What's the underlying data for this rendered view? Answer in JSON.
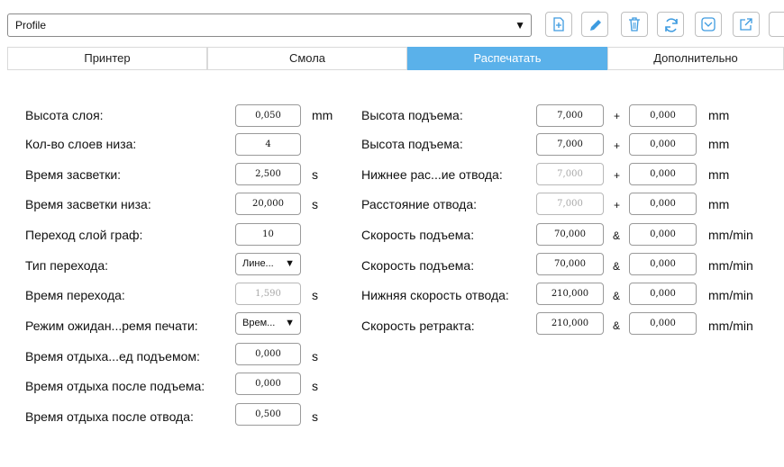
{
  "profile": {
    "value": "Profile"
  },
  "toolbar": {
    "buttons": [
      "new-profile",
      "edit",
      "delete",
      "refresh",
      "import",
      "export",
      "more"
    ]
  },
  "tabs": [
    {
      "label": "Принтер",
      "active": false
    },
    {
      "label": "Смола",
      "active": false
    },
    {
      "label": "Распечатать",
      "active": true
    },
    {
      "label": "Дополнительно",
      "active": false
    }
  ],
  "left": [
    {
      "label": "Высота слоя:",
      "value": "0,050",
      "unit": "mm"
    },
    {
      "label": "Кол-во слоев низа:",
      "value": "4",
      "unit": ""
    },
    {
      "label": "Время засветки:",
      "value": "2,500",
      "unit": "s"
    },
    {
      "label": "Время засветки низа:",
      "value": "20,000",
      "unit": "s"
    },
    {
      "label": "Переход слой граф:",
      "value": "10",
      "unit": ""
    },
    {
      "label": "Тип перехода:",
      "value": "Лине...",
      "unit": ""
    },
    {
      "label": "Время перехода:",
      "value": "1,590",
      "unit": "s"
    },
    {
      "label": "Режим ожидан...ремя печати:",
      "value": "Врем...",
      "unit": ""
    },
    {
      "label": "Время отдыха...ед подъемом:",
      "value": "0,000",
      "unit": "s"
    },
    {
      "label": "Время отдыха после подъема:",
      "value": "0,000",
      "unit": "s"
    },
    {
      "label": "Время отдыха после отвода:",
      "value": "0,500",
      "unit": "s"
    }
  ],
  "right": [
    {
      "label": "Высота подъема:",
      "value1": "7,000",
      "op": "+",
      "value2": "0,000",
      "unit": "mm"
    },
    {
      "label": "Высота подъема:",
      "value1": "7,000",
      "op": "+",
      "value2": "0,000",
      "unit": "mm"
    },
    {
      "label": "Нижнее рас...ие отвода:",
      "value1": "7,000",
      "op": "+",
      "value2": "0,000",
      "unit": "mm"
    },
    {
      "label": "Расстояние отвода:",
      "value1": "7,000",
      "op": "+",
      "value2": "0,000",
      "unit": "mm"
    },
    {
      "label": "Скорость подъема:",
      "value1": "70,000",
      "op": "&",
      "value2": "0,000",
      "unit": "mm/min"
    },
    {
      "label": "Скорость подъема:",
      "value1": "70,000",
      "op": "&",
      "value2": "0,000",
      "unit": "mm/min"
    },
    {
      "label": "Нижняя скорость отвода:",
      "value1": "210,000",
      "op": "&",
      "value2": "0,000",
      "unit": "mm/min"
    },
    {
      "label": "Скорость ретракта:",
      "value1": "210,000",
      "op": "&",
      "value2": "0,000",
      "unit": "mm/min"
    }
  ],
  "colors": {
    "accent": "#5ab1ea",
    "icon": "#3d9be0"
  }
}
